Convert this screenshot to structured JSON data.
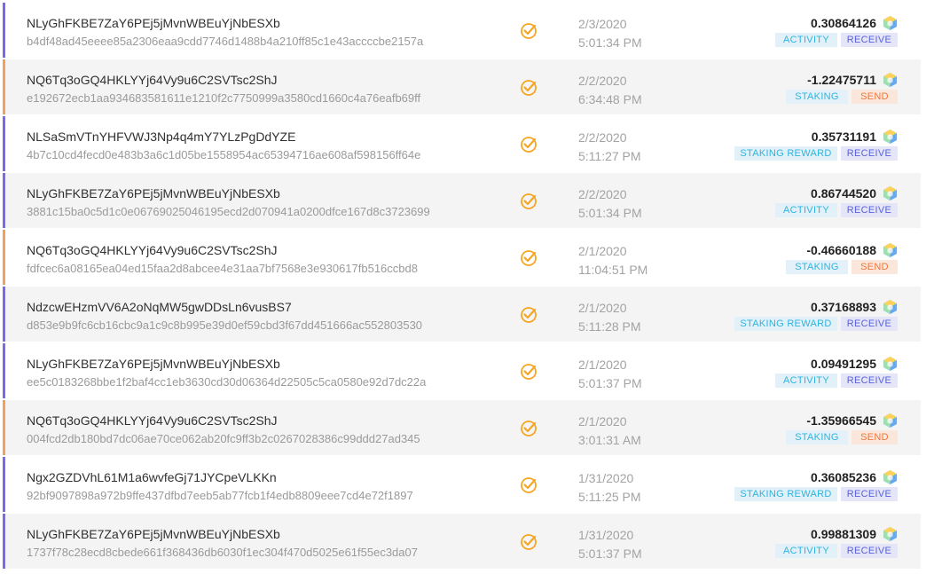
{
  "transactions": [
    {
      "address": "NLyGhFKBE7ZaY6PEj5jMvnWBEuYjNbESXb",
      "hash": "b4df48ad45eeee85a2306eaa9cdd7746d1488b4a210ff85c1e43accccbe2157a",
      "date": "2/3/2020",
      "time": "5:01:34 PM",
      "amount": "0.30864126",
      "category": "ACTIVITY",
      "direction": "RECEIVE"
    },
    {
      "address": "NQ6Tq3oGQ4HKLYYj64Vy9u6C2SVTsc2ShJ",
      "hash": "e192672ecb1aa934683581611e1210f2c7750999a3580cd1660c4a76eafb69ff",
      "date": "2/2/2020",
      "time": "6:34:48 PM",
      "amount": "-1.22475711",
      "category": "STAKING",
      "direction": "SEND"
    },
    {
      "address": "NLSaSmVTnYHFVWJ3Np4q4mY7YLzPgDdYZE",
      "hash": "4b7c10cd4fecd0e483b3a6c1d05be1558954ac65394716ae608af598156ff64e",
      "date": "2/2/2020",
      "time": "5:11:27 PM",
      "amount": "0.35731191",
      "category": "STAKING REWARD",
      "direction": "RECEIVE"
    },
    {
      "address": "NLyGhFKBE7ZaY6PEj5jMvnWBEuYjNbESXb",
      "hash": "3881c15ba0c5d1c0e06769025046195ecd2d070941a0200dfce167d8c3723699",
      "date": "2/2/2020",
      "time": "5:01:34 PM",
      "amount": "0.86744520",
      "category": "ACTIVITY",
      "direction": "RECEIVE"
    },
    {
      "address": "NQ6Tq3oGQ4HKLYYj64Vy9u6C2SVTsc2ShJ",
      "hash": "fdfcec6a08165ea04ed15faa2d8abcee4e31aa7bf7568e3e930617fb516ccbd8",
      "date": "2/1/2020",
      "time": "11:04:51 PM",
      "amount": "-0.46660188",
      "category": "STAKING",
      "direction": "SEND"
    },
    {
      "address": "NdzcwEHzmVV6A2oNqMW5gwDDsLn6vusBS7",
      "hash": "d853e9b9fc6cb16cbc9a1c9c8b995e39d0ef59cbd3f67dd451666ac552803530",
      "date": "2/1/2020",
      "time": "5:11:28 PM",
      "amount": "0.37168893",
      "category": "STAKING REWARD",
      "direction": "RECEIVE"
    },
    {
      "address": "NLyGhFKBE7ZaY6PEj5jMvnWBEuYjNbESXb",
      "hash": "ee5c0183268bbe1f2baf4cc1eb3630cd30d06364d22505c5ca0580e92d7dc22a",
      "date": "2/1/2020",
      "time": "5:01:37 PM",
      "amount": "0.09491295",
      "category": "ACTIVITY",
      "direction": "RECEIVE"
    },
    {
      "address": "NQ6Tq3oGQ4HKLYYj64Vy9u6C2SVTsc2ShJ",
      "hash": "004fcd2db180bd7dc06ae70ce062ab20fc9ff3b2c0267028386c99ddd27ad345",
      "date": "2/1/2020",
      "time": "3:01:31 AM",
      "amount": "-1.35966545",
      "category": "STAKING",
      "direction": "SEND"
    },
    {
      "address": "Ngx2GZDVhL61M1a6wvfeGj71JYCpeVLKKn",
      "hash": "92bf9097898a972b9ffe437dfbd7eeb5ab77fcb1f4edb8809eee7cd4e72f1897",
      "date": "1/31/2020",
      "time": "5:11:25 PM",
      "amount": "0.36085236",
      "category": "STAKING REWARD",
      "direction": "RECEIVE"
    },
    {
      "address": "NLyGhFKBE7ZaY6PEj5jMvnWBEuYjNbESXb",
      "hash": "1737f78c28ecd8cbede661f368436db6030f1ec304f470d5025e61f55ec3da07",
      "date": "1/31/2020",
      "time": "5:01:37 PM",
      "amount": "0.99881309",
      "category": "ACTIVITY",
      "direction": "RECEIVE"
    }
  ],
  "icons": {
    "status": "check-circle-icon",
    "coin": "coin-icon"
  },
  "colors": {
    "receive_accent": "#7b68ee",
    "send_accent": "#f5a05a",
    "status_check": "#f5a623"
  }
}
